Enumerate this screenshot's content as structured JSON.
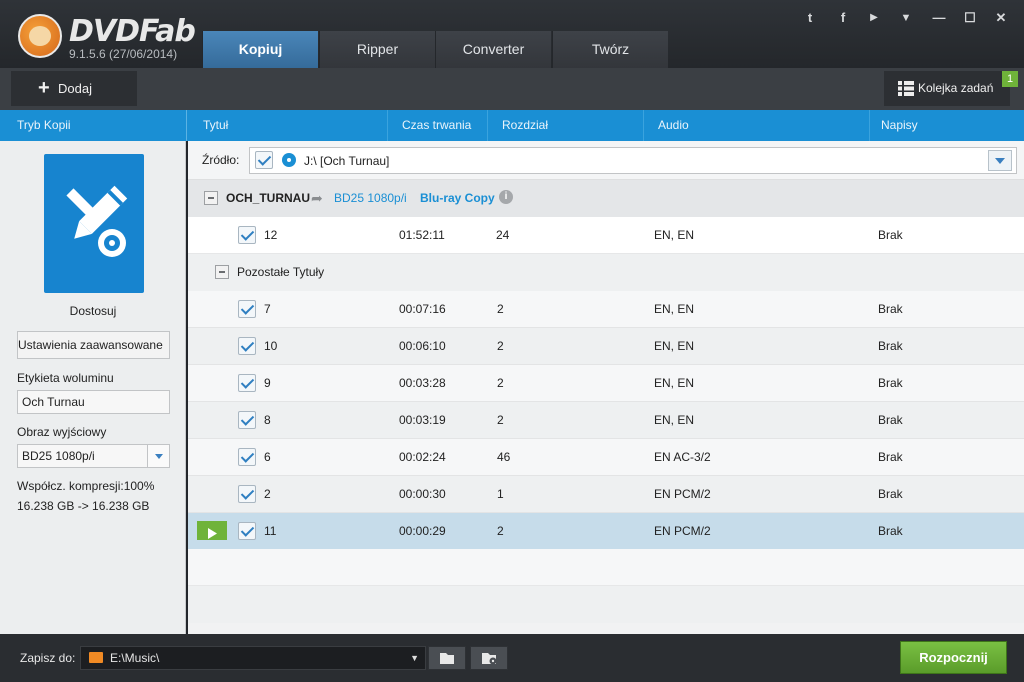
{
  "app": {
    "logo": "DVDFab",
    "version": "9.1.5.6 (27/06/2014)"
  },
  "tabs": [
    {
      "label": "Kopiuj",
      "active": true
    },
    {
      "label": "Ripper"
    },
    {
      "label": "Converter"
    },
    {
      "label": "Twórz"
    }
  ],
  "window_controls": [
    "twitter-icon",
    "facebook-icon",
    "youtube-icon",
    "dropdown-icon",
    "minimize-icon",
    "maximize-icon",
    "close-icon"
  ],
  "window_glyphs": {
    "twitter": "t",
    "facebook": "f",
    "youtube": "▶",
    "dropdown": "▼",
    "minimize": "—",
    "maximize": "☐",
    "close": "✕"
  },
  "toolbar": {
    "add_label": "Dodaj",
    "queue_label": "Kolejka zadań",
    "queue_count": "1"
  },
  "sidebar": {
    "header": "Tryb Kopii",
    "profile": "Dostosuj",
    "advanced_button": "Ustawienia zaawansowane",
    "volume_label_title": "Etykieta woluminu",
    "volume_label": "Och Turnau",
    "output_title": "Obraz wyjściowy",
    "output_value": "BD25 1080p/i",
    "compression": "Współcz. kompresji:100%",
    "size": "16.238 GB -> 16.238 GB"
  },
  "columns": [
    "Tytuł",
    "Czas trwania",
    "Rozdział",
    "Audio",
    "Napisy"
  ],
  "source": {
    "label": "Źródło:",
    "value": "J:\\ [Och Turnau]"
  },
  "disc": {
    "name": "OCH_TURNAU",
    "target": "BD25 1080p/i",
    "mode": "Blu-ray Copy"
  },
  "main_title": {
    "title": "12",
    "duration": "01:52:11",
    "chapters": "24",
    "audio": "EN, EN",
    "subtitles": "Brak"
  },
  "other_group": "Pozostałe Tytuły",
  "titles": [
    {
      "title": "7",
      "duration": "00:07:16",
      "chapters": "2",
      "audio": "EN, EN",
      "subtitles": "Brak"
    },
    {
      "title": "10",
      "duration": "00:06:10",
      "chapters": "2",
      "audio": "EN, EN",
      "subtitles": "Brak"
    },
    {
      "title": "9",
      "duration": "00:03:28",
      "chapters": "2",
      "audio": "EN, EN",
      "subtitles": "Brak"
    },
    {
      "title": "8",
      "duration": "00:03:19",
      "chapters": "2",
      "audio": "EN, EN",
      "subtitles": "Brak"
    },
    {
      "title": "6",
      "duration": "00:02:24",
      "chapters": "46",
      "audio": "EN AC-3/2",
      "subtitles": "Brak"
    },
    {
      "title": "2",
      "duration": "00:00:30",
      "chapters": "1",
      "audio": "EN PCM/2",
      "subtitles": "Brak"
    },
    {
      "title": "11",
      "duration": "00:00:29",
      "chapters": "2",
      "audio": "EN PCM/2",
      "subtitles": "Brak",
      "selected": true
    }
  ],
  "bottom": {
    "save_label": "Zapisz do:",
    "path": "E:\\Music\\",
    "start_label": "Rozpocznij"
  },
  "colors": {
    "accent": "#1a8fd4",
    "start": "#5fa62e",
    "selected_row": "#c6dcea"
  }
}
